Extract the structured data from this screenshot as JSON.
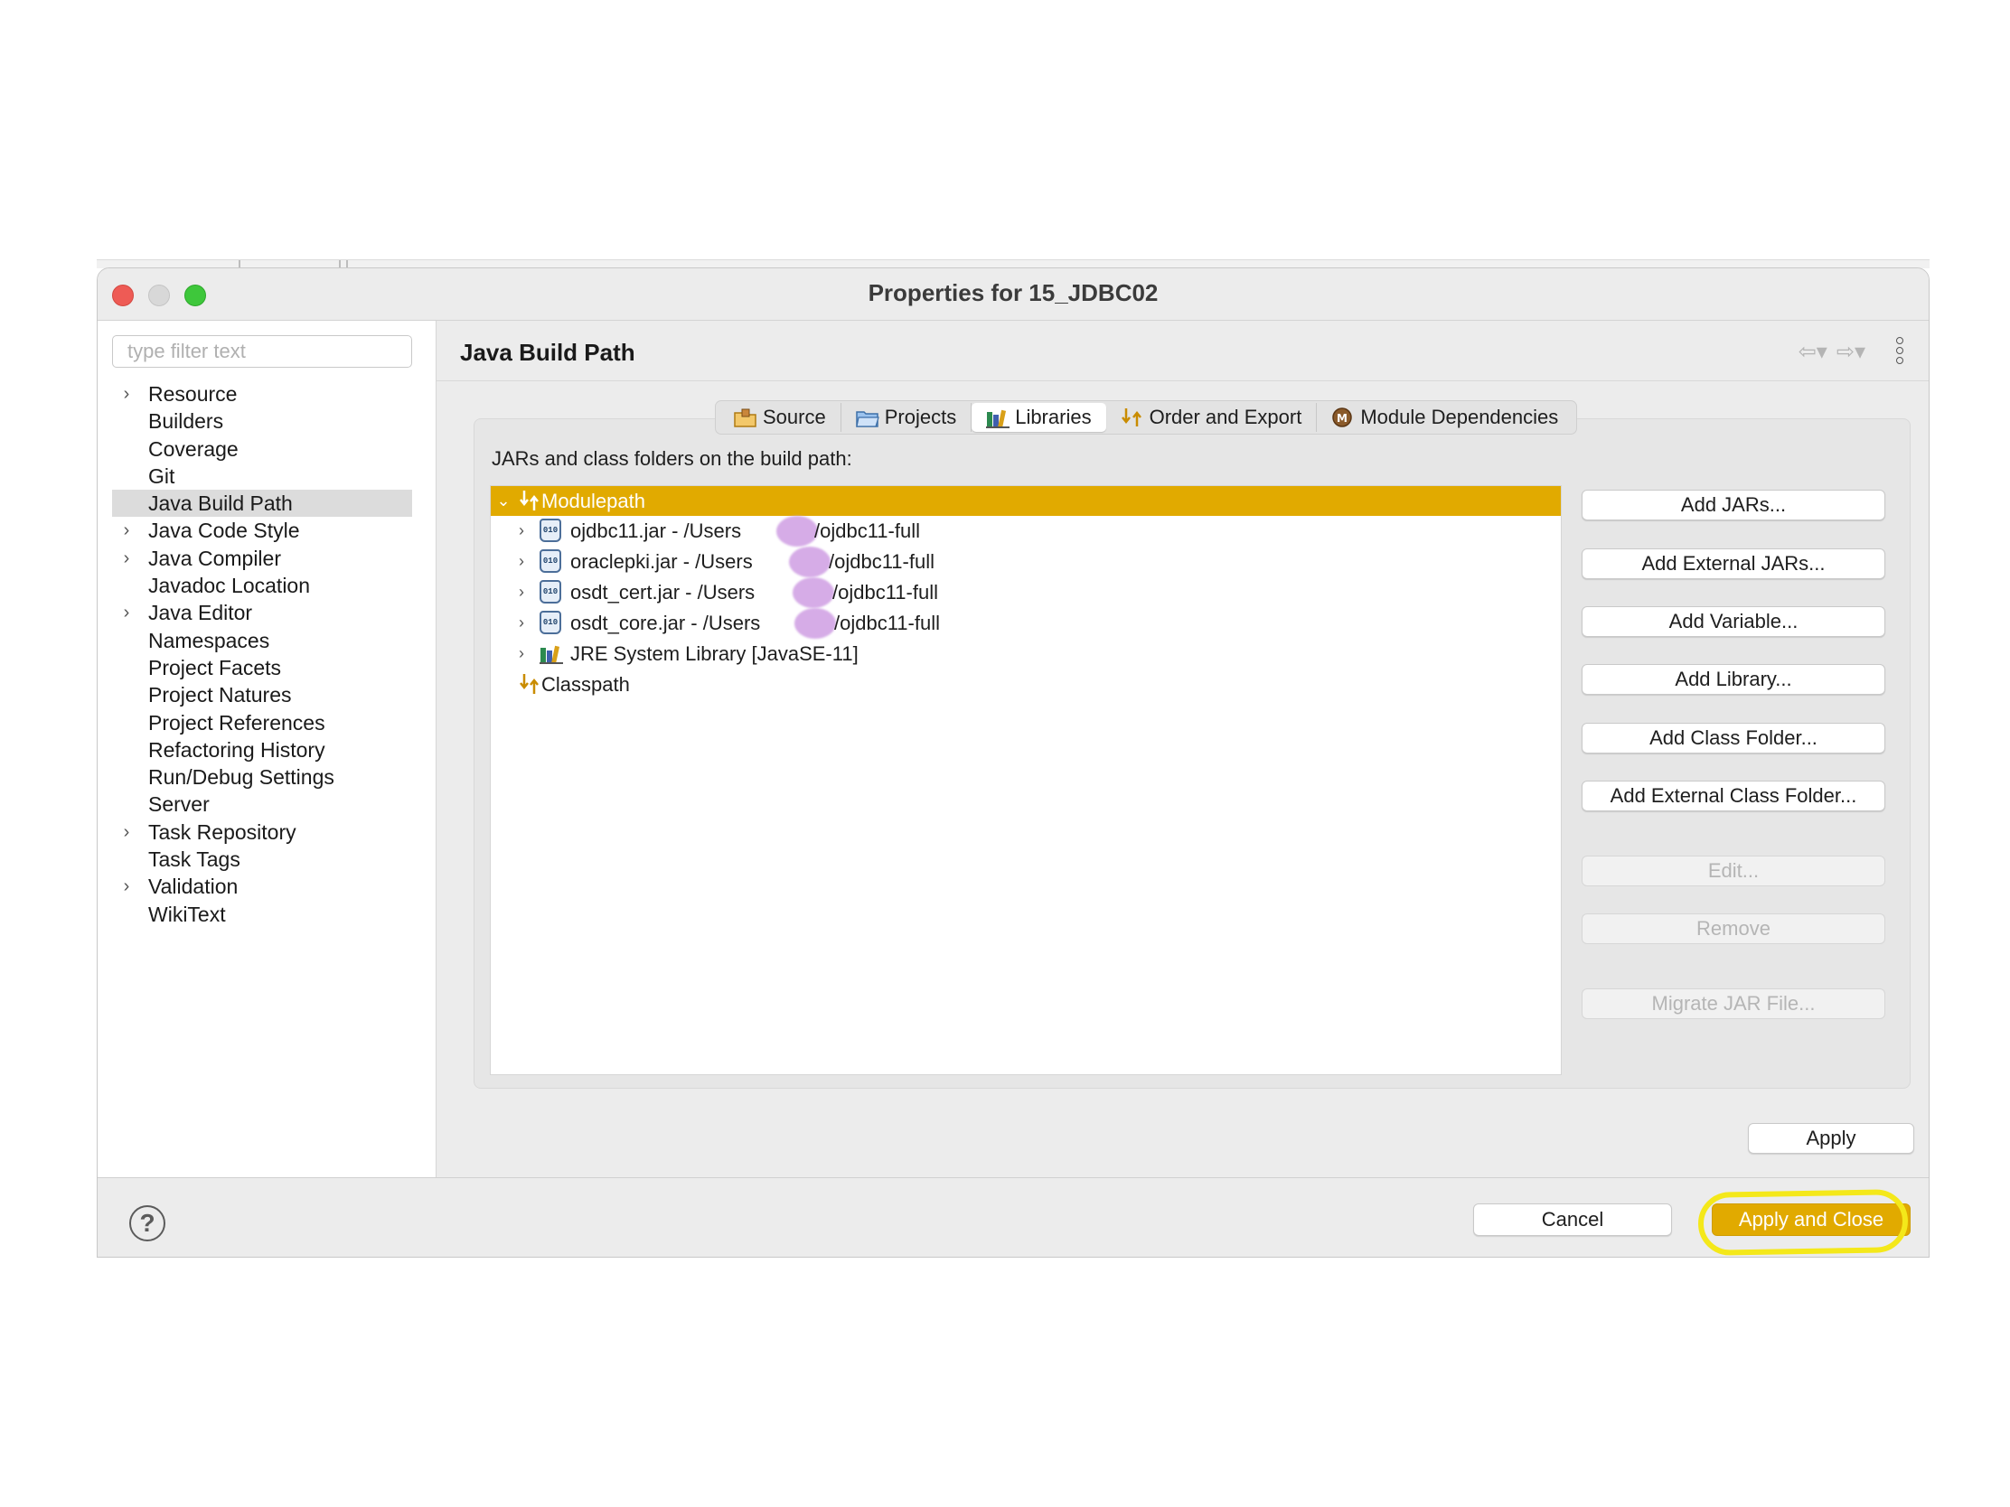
{
  "window": {
    "title": "Properties for 15_JDBC02"
  },
  "filter": {
    "placeholder": "type filter text"
  },
  "nav": [
    {
      "label": "Resource",
      "expandable": true
    },
    {
      "label": "Builders",
      "expandable": false
    },
    {
      "label": "Coverage",
      "expandable": false
    },
    {
      "label": "Git",
      "expandable": false
    },
    {
      "label": "Java Build Path",
      "expandable": false,
      "selected": true
    },
    {
      "label": "Java Code Style",
      "expandable": true
    },
    {
      "label": "Java Compiler",
      "expandable": true
    },
    {
      "label": "Javadoc Location",
      "expandable": false
    },
    {
      "label": "Java Editor",
      "expandable": true
    },
    {
      "label": "Namespaces",
      "expandable": false
    },
    {
      "label": "Project Facets",
      "expandable": false
    },
    {
      "label": "Project Natures",
      "expandable": false
    },
    {
      "label": "Project References",
      "expandable": false
    },
    {
      "label": "Refactoring History",
      "expandable": false
    },
    {
      "label": "Run/Debug Settings",
      "expandable": false
    },
    {
      "label": "Server",
      "expandable": false
    },
    {
      "label": "Task Repository",
      "expandable": true
    },
    {
      "label": "Task Tags",
      "expandable": false
    },
    {
      "label": "Validation",
      "expandable": true
    },
    {
      "label": "WikiText",
      "expandable": false
    }
  ],
  "page": {
    "heading": "Java Build Path",
    "build_path_label": "JARs and class folders on the build path:"
  },
  "tabs": [
    {
      "label": "Source",
      "icon": "source-folder-icon"
    },
    {
      "label": "Projects",
      "icon": "projects-folder-icon"
    },
    {
      "label": "Libraries",
      "icon": "libraries-icon",
      "active": true
    },
    {
      "label": "Order and Export",
      "icon": "order-export-icon"
    },
    {
      "label": "Module Dependencies",
      "icon": "module-icon"
    }
  ],
  "tree": {
    "modulepath": "Modulepath",
    "jars": [
      {
        "name_prefix": "ojdbc11.jar - /Users",
        "name_suffix": "/ojdbc11-full"
      },
      {
        "name_prefix": "oraclepki.jar - /Users",
        "name_suffix": "/ojdbc11-full"
      },
      {
        "name_prefix": "osdt_cert.jar - /Users",
        "name_suffix": "/ojdbc11-full"
      },
      {
        "name_prefix": "osdt_core.jar - /Users",
        "name_suffix": "/ojdbc11-full"
      }
    ],
    "jre": "JRE System Library [JavaSE-11]",
    "classpath": "Classpath"
  },
  "buttons": {
    "add_jars": "Add JARs...",
    "add_external_jars": "Add External JARs...",
    "add_variable": "Add Variable...",
    "add_library": "Add Library...",
    "add_class_folder": "Add Class Folder...",
    "add_external_class_folder": "Add External Class Folder...",
    "edit": "Edit...",
    "remove": "Remove",
    "migrate_jar": "Migrate JAR File...",
    "apply": "Apply",
    "cancel": "Cancel",
    "apply_and_close": "Apply and Close"
  },
  "colors": {
    "accent": "#e1aa00",
    "highlight_ring": "#f4e81a",
    "redaction": "#d4a8e6"
  }
}
